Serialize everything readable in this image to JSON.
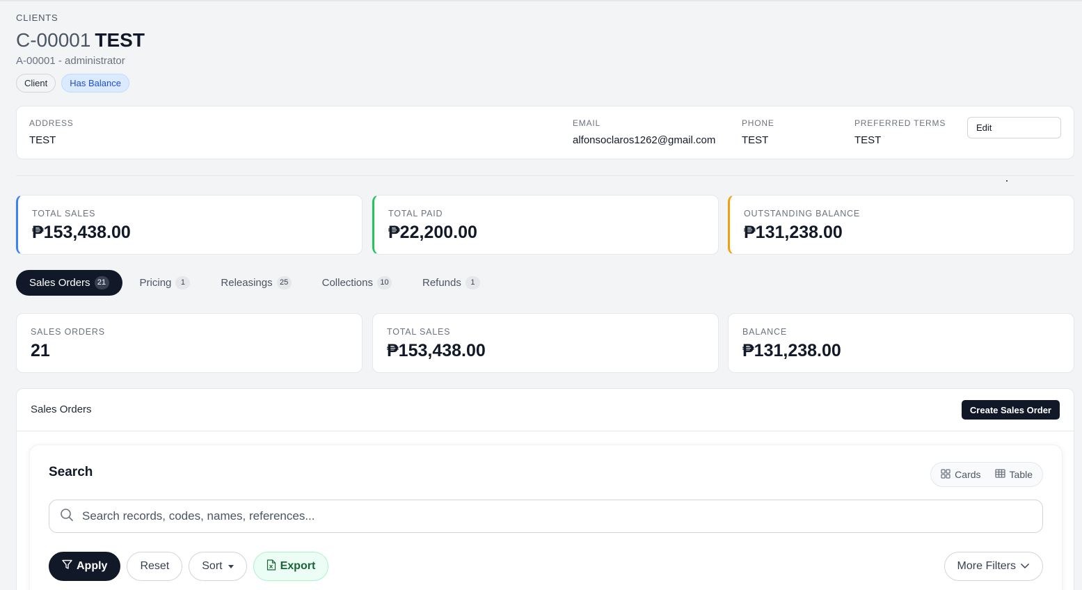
{
  "header": {
    "breadcrumb": "CLIENTS",
    "code": "C-00001",
    "name": "TEST",
    "subtitle": "A-00001 - administrator",
    "chips": [
      "Client",
      "Has Balance"
    ]
  },
  "info": {
    "address_label": "ADDRESS",
    "address": "TEST",
    "email_label": "EMAIL",
    "email": "alfonsoclaros1262@gmail.com",
    "phone_label": "PHONE",
    "phone": "TEST",
    "terms_label": "PREFERRED TERMS",
    "terms": "TEST",
    "edit_label": "Edit"
  },
  "summary": [
    {
      "label": "TOTAL SALES",
      "value": "₱153,438.00",
      "color": "#3b82f6"
    },
    {
      "label": "TOTAL PAID",
      "value": "₱22,200.00",
      "color": "#22c55e"
    },
    {
      "label": "OUTSTANDING BALANCE",
      "value": "₱131,238.00",
      "color": "#f59e0b"
    }
  ],
  "tabs": [
    {
      "label": "Sales Orders",
      "count": "21",
      "active": true
    },
    {
      "label": "Pricing",
      "count": "1"
    },
    {
      "label": "Releasings",
      "count": "25"
    },
    {
      "label": "Collections",
      "count": "10"
    },
    {
      "label": "Refunds",
      "count": "1"
    }
  ],
  "tab_stats": [
    {
      "label": "SALES ORDERS",
      "value": "21"
    },
    {
      "label": "TOTAL SALES",
      "value": "₱153,438.00"
    },
    {
      "label": "BALANCE",
      "value": "₱131,238.00"
    }
  ],
  "panel": {
    "title": "Sales Orders",
    "create_label": "Create Sales Order",
    "search_title": "Search",
    "view_cards": "Cards",
    "view_table": "Table",
    "search_placeholder": "Search records, codes, names, references...",
    "apply": "Apply",
    "reset": "Reset",
    "sort": "Sort",
    "export": "Export",
    "more_filters": "More Filters"
  }
}
